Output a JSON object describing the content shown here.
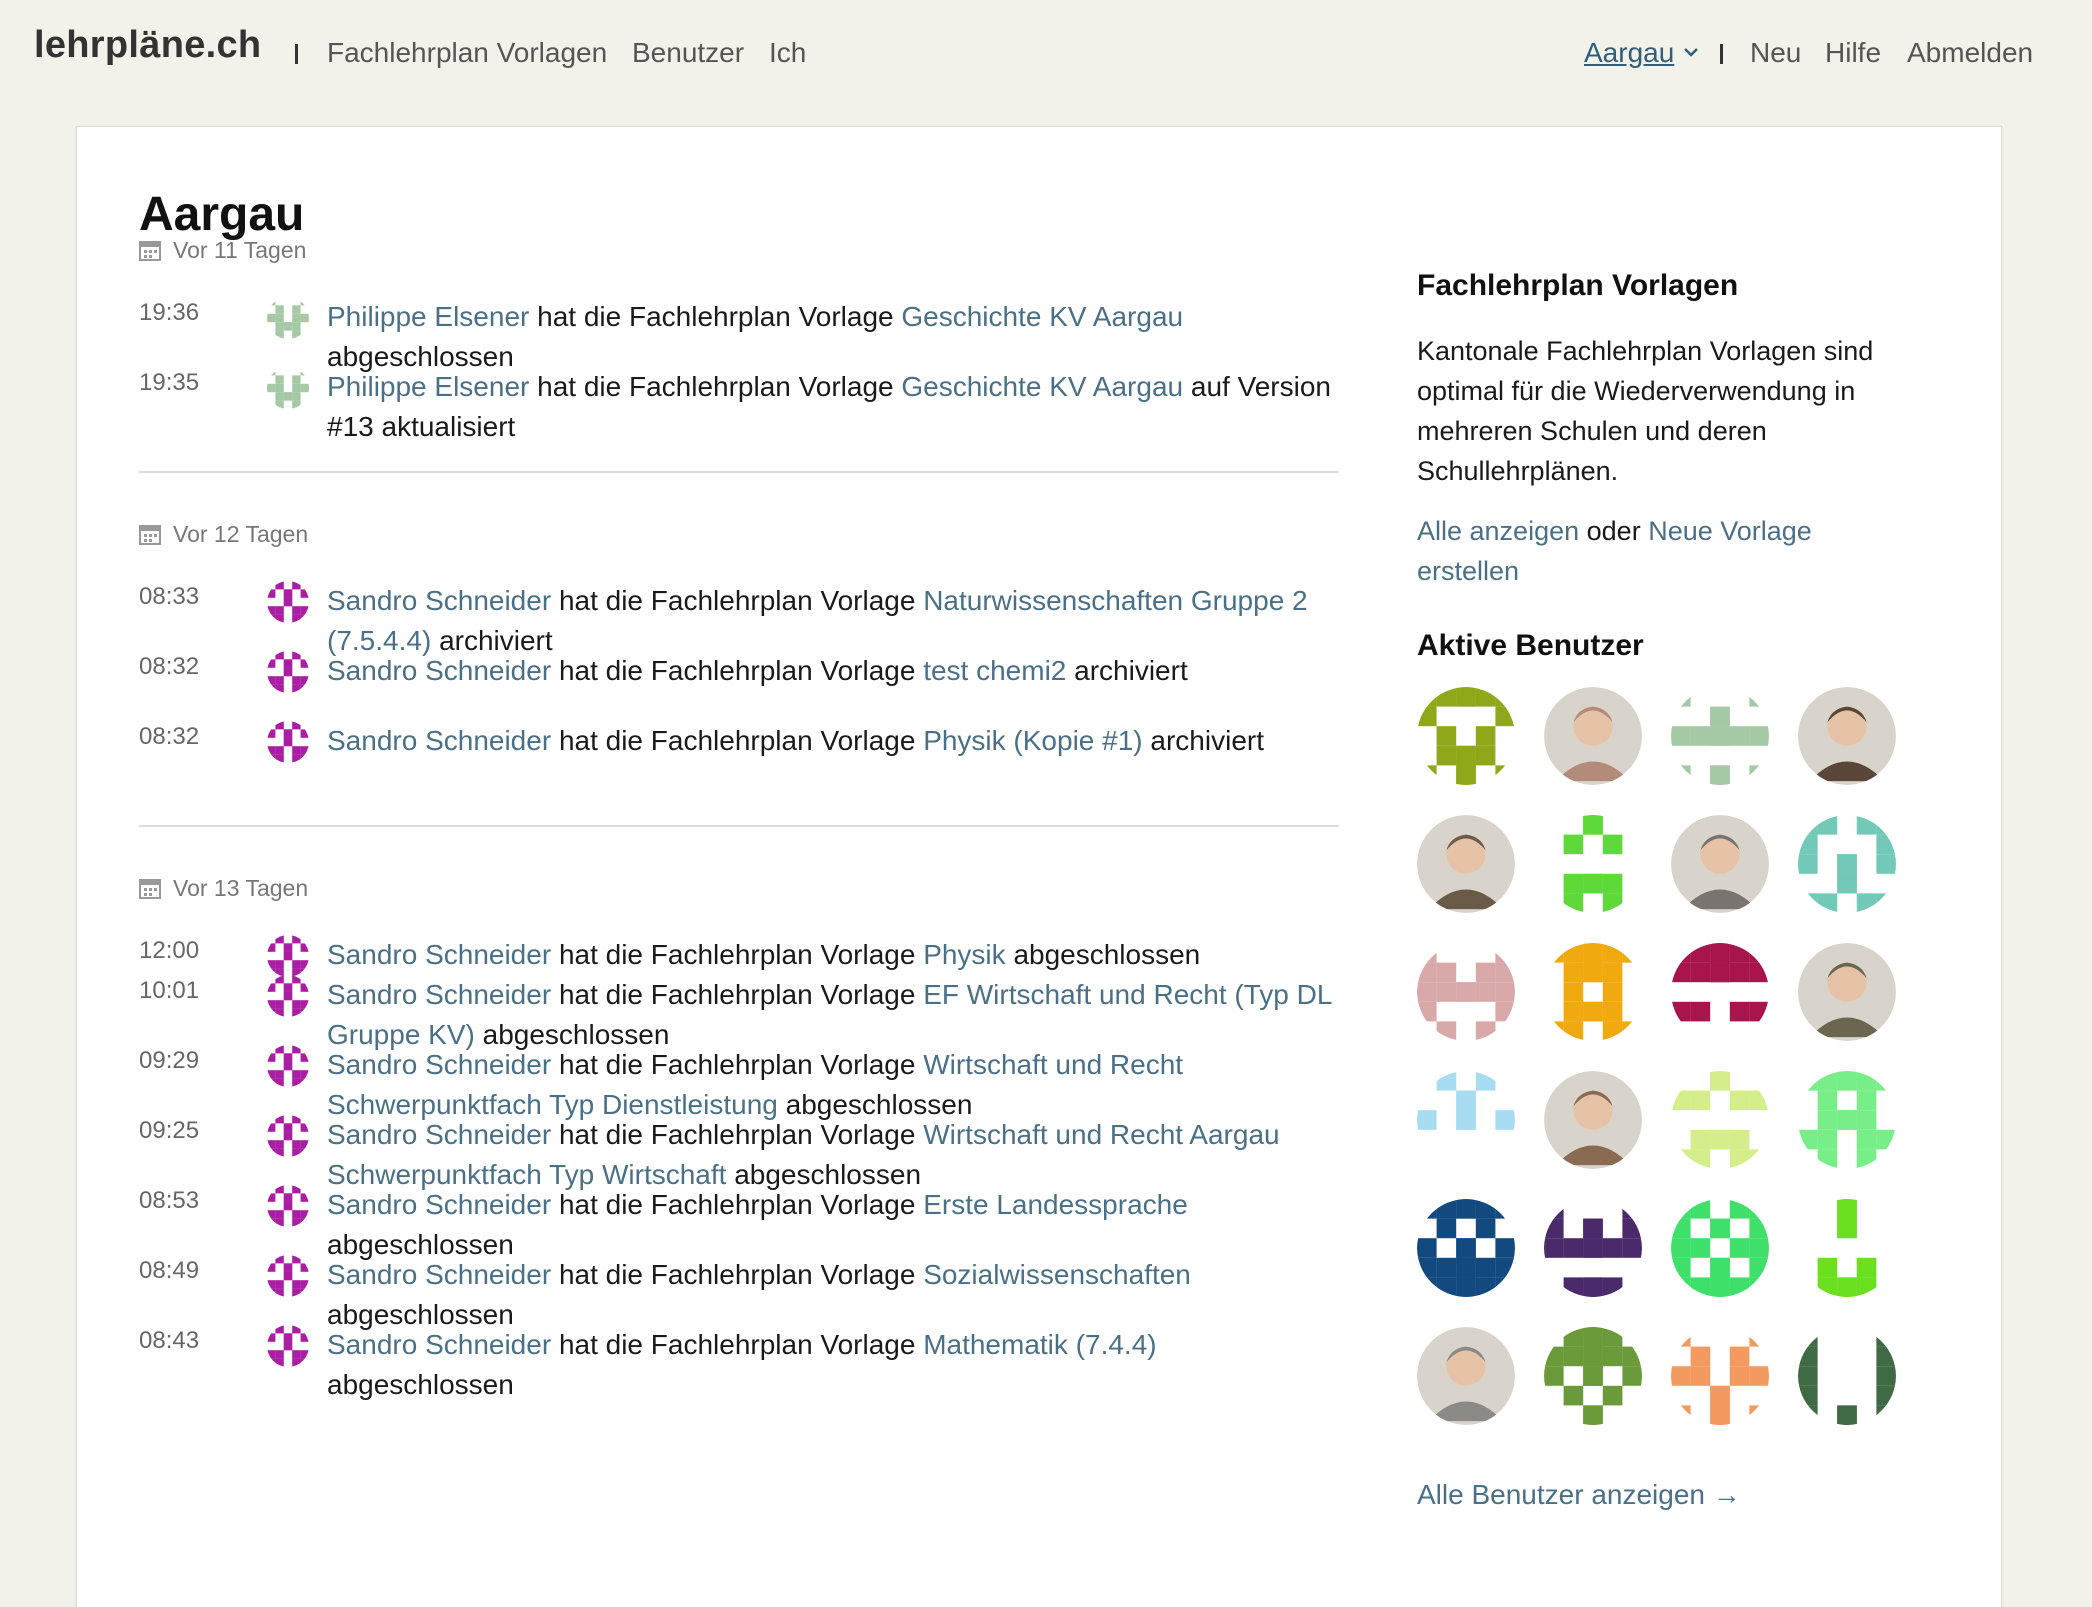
{
  "nav": {
    "brand": "lehrpläne.ch",
    "left_links": [
      "Fachlehrplan Vorlagen",
      "Benutzer",
      "Ich"
    ],
    "region": "Aargau",
    "right_links": [
      "Neu",
      "Hilfe",
      "Abmelden"
    ]
  },
  "page_title": "Aargau",
  "feed": [
    {
      "day": "Vor 11 Tagen",
      "entries": [
        {
          "time": "19:36",
          "user": "Philippe Elsener",
          "action": "hat die Fachlehrplan Vorlage",
          "target": "Geschichte KV Aargau",
          "suffix": "abgeschlossen"
        },
        {
          "time": "19:35",
          "user": "Philippe Elsener",
          "action": "hat die Fachlehrplan Vorlage",
          "target": "Geschichte KV Aargau",
          "suffix": "auf Version #13 aktualisiert"
        }
      ]
    },
    {
      "day": "Vor 12 Tagen",
      "entries": [
        {
          "time": "08:33",
          "user": "Sandro Schneider",
          "action": "hat die Fachlehrplan Vorlage",
          "target": "Naturwissenschaften Gruppe 2 (7.5.4.4)",
          "suffix": "archiviert"
        },
        {
          "time": "08:32",
          "user": "Sandro Schneider",
          "action": "hat die Fachlehrplan Vorlage",
          "target": "test chemi2",
          "suffix": "archiviert"
        },
        {
          "time": "08:32",
          "user": "Sandro Schneider",
          "action": "hat die Fachlehrplan Vorlage",
          "target": "Physik (Kopie #1)",
          "suffix": "archiviert"
        }
      ]
    },
    {
      "day": "Vor 13 Tagen",
      "entries": [
        {
          "time": "12:00",
          "user": "Sandro Schneider",
          "action": "hat die Fachlehrplan Vorlage",
          "target": "Physik",
          "suffix": "abgeschlossen"
        },
        {
          "time": "10:01",
          "user": "Sandro Schneider",
          "action": "hat die Fachlehrplan Vorlage",
          "target": "EF Wirtschaft und Recht (Typ DL Gruppe KV)",
          "suffix": "abgeschlossen"
        },
        {
          "time": "09:29",
          "user": "Sandro Schneider",
          "action": "hat die Fachlehrplan Vorlage",
          "target": "Wirtschaft und Recht Schwerpunktfach Typ Dienstleistung",
          "suffix": "abgeschlossen"
        },
        {
          "time": "09:25",
          "user": "Sandro Schneider",
          "action": "hat die Fachlehrplan Vorlage",
          "target": "Wirtschaft und Recht Aargau Schwerpunktfach Typ Wirtschaft",
          "suffix": "abgeschlossen"
        },
        {
          "time": "08:53",
          "user": "Sandro Schneider",
          "action": "hat die Fachlehrplan Vorlage",
          "target": "Erste Landessprache",
          "suffix": "abgeschlossen"
        },
        {
          "time": "08:49",
          "user": "Sandro Schneider",
          "action": "hat die Fachlehrplan Vorlage",
          "target": "Sozialwissenschaften",
          "suffix": "abgeschlossen"
        },
        {
          "time": "08:43",
          "user": "Sandro Schneider",
          "action": "hat die Fachlehrplan Vorlage",
          "target": "Mathematik (7.4.4)",
          "suffix": "abgeschlossen"
        }
      ]
    }
  ],
  "sidebar": {
    "templates_title": "Fachlehrplan Vorlagen",
    "templates_text": "Kantonale Fachlehrplan Vorlagen sind optimal für die Wiederverwendung in mehreren Schulen und deren Schullehrplänen.",
    "show_all": "Alle anzeigen",
    "or": "oder",
    "new_template": "Neue Vorlage erstellen",
    "active_users_title": "Aktive Benutzer",
    "all_users_link": "Alle Benutzer anzeigen →"
  },
  "avatar_colors": {
    "philippe": "#a5c9a5",
    "sandro": "#a91ea3"
  },
  "active_users": [
    {
      "kind": "identicon",
      "color": "#8fa81a"
    },
    {
      "kind": "photo",
      "color": "#b38b7a"
    },
    {
      "kind": "identicon",
      "color": "#a5c9a5"
    },
    {
      "kind": "photo",
      "color": "#5a4638"
    },
    {
      "kind": "photo",
      "color": "#6a5a48"
    },
    {
      "kind": "identicon",
      "color": "#5fd83a"
    },
    {
      "kind": "photo",
      "color": "#7a7470"
    },
    {
      "kind": "identicon",
      "color": "#72c9b8"
    },
    {
      "kind": "identicon",
      "color": "#d9a9a9"
    },
    {
      "kind": "identicon",
      "color": "#f0aa10"
    },
    {
      "kind": "identicon",
      "color": "#a8154c"
    },
    {
      "kind": "photo",
      "color": "#6b6650"
    },
    {
      "kind": "identicon",
      "color": "#a7dcf3"
    },
    {
      "kind": "photo",
      "color": "#8a6a52"
    },
    {
      "kind": "identicon",
      "color": "#d4ee8c"
    },
    {
      "kind": "identicon",
      "color": "#78ee88"
    },
    {
      "kind": "identicon",
      "color": "#124a80"
    },
    {
      "kind": "identicon",
      "color": "#4a2a6a"
    },
    {
      "kind": "identicon",
      "color": "#3ee06a"
    },
    {
      "kind": "identicon",
      "color": "#6ae01e"
    },
    {
      "kind": "photo",
      "color": "#8c8a86"
    },
    {
      "kind": "identicon",
      "color": "#6a9a3a"
    },
    {
      "kind": "identicon",
      "color": "#f29a60"
    },
    {
      "kind": "identicon",
      "color": "#3f6a44"
    }
  ]
}
